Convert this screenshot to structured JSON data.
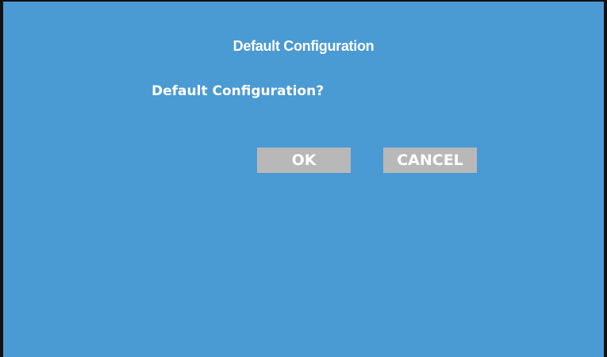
{
  "dialog": {
    "title": "Default Configuration",
    "prompt": "Default Configuration?",
    "ok_label": "OK",
    "cancel_label": "CANCEL"
  },
  "colors": {
    "background": "#4a9ad4",
    "button": "#b8b8b8",
    "text": "#ffffff",
    "frame": "#111111"
  }
}
